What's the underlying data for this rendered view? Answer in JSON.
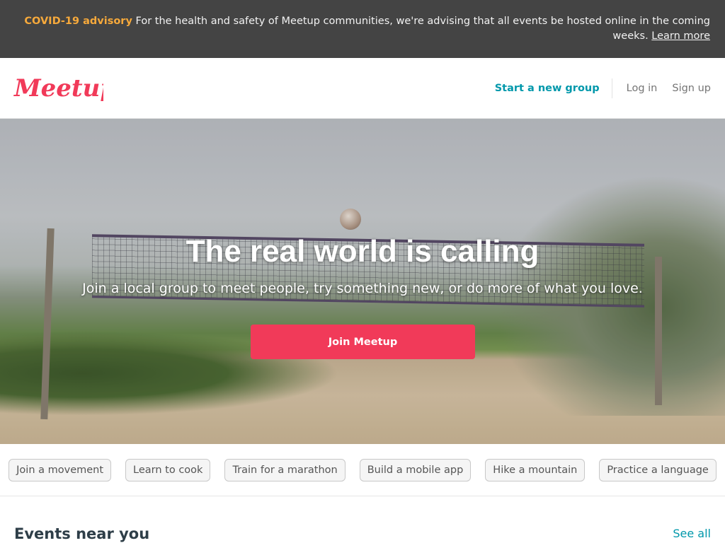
{
  "advisory": {
    "tag": "COVID-19 advisory",
    "message": "For the health and safety of Meetup communities, we're advising that all events be hosted online in the coming weeks.",
    "link": "Learn more"
  },
  "header": {
    "logo_text": "Meetup",
    "start_group": "Start a new group",
    "login": "Log in",
    "signup": "Sign up"
  },
  "hero": {
    "title": "The real world is calling",
    "subtitle": "Join a local group to meet people, try something new, or do more of what you love.",
    "cta": "Join Meetup"
  },
  "topics": [
    "Join a movement",
    "Learn to cook",
    "Train for a marathon",
    "Build a mobile app",
    "Hike a mountain",
    "Practice a language"
  ],
  "events": {
    "title": "Events near you",
    "see_all": "See all"
  },
  "colors": {
    "brand": "#f13a59",
    "accent": "#0098ab",
    "advisory_tag": "#f6a93b",
    "advisory_bg": "#444444"
  }
}
